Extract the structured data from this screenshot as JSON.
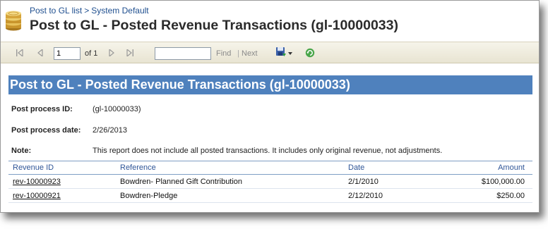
{
  "breadcrumb": {
    "link1": "Post to GL list",
    "separator": ">",
    "link2": "System Default"
  },
  "page_title": "Post to GL - Posted Revenue Transactions (gl-10000033)",
  "toolbar": {
    "page_value": "1",
    "page_of": "of 1",
    "find_value": "",
    "find_label": "Find",
    "separator": "|",
    "next_label": "Next",
    "icons": [
      "first-page-icon",
      "previous-page-icon",
      "next-page-icon",
      "last-page-icon",
      "export-icon",
      "dropdown-arrow-icon",
      "refresh-icon"
    ]
  },
  "report": {
    "banner": "Post to GL - Posted Revenue Transactions (gl-10000033)",
    "fields": {
      "post_process_id_label": "Post process ID:",
      "post_process_id_value": "(gl-10000033)",
      "post_process_date_label": "Post process date:",
      "post_process_date_value": "2/26/2013",
      "note_label": "Note:",
      "note_value": "This report does not include all posted transactions. It includes only original revenue, not adjustments."
    },
    "columns": [
      "Revenue ID",
      "Reference",
      "Date",
      "Amount"
    ],
    "rows": [
      {
        "revenue_id": "rev-10000923",
        "reference": "Bowdren- Planned Gift Contribution",
        "date": "2/1/2010",
        "amount": "$100,000.00"
      },
      {
        "revenue_id": "rev-10000921",
        "reference": "Bowdren-Pledge",
        "date": "2/12/2010",
        "amount": "$250.00"
      }
    ]
  },
  "colors": {
    "banner_bg": "#4f81bd",
    "header_text": "#2f5597",
    "link": "#1f4f8f",
    "toolbar_bg": "#efece0"
  }
}
